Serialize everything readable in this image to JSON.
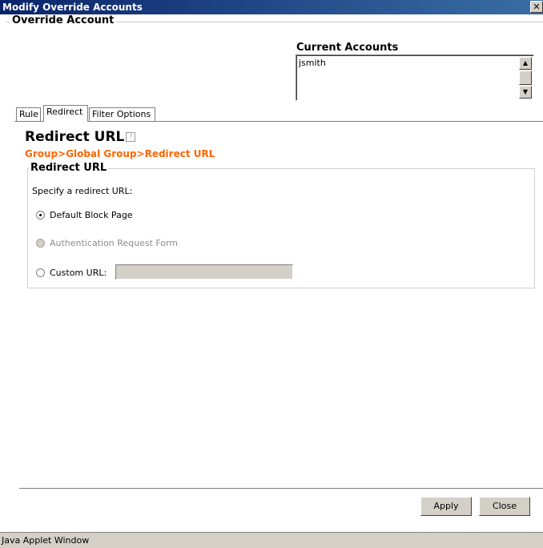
{
  "window": {
    "title": "Modify Override Accounts",
    "close_glyph": "✕"
  },
  "override_group": {
    "label": "Override Account"
  },
  "current_accounts": {
    "label": "Current Accounts",
    "items": [
      "jsmith"
    ]
  },
  "tabs": [
    {
      "label": "Rule",
      "active": false
    },
    {
      "label": "Redirect",
      "active": true
    },
    {
      "label": "Filter Options",
      "active": false
    }
  ],
  "redirect": {
    "title": "Redirect URL",
    "help_glyph": "?",
    "breadcrumb": "Group>Global Group>Redirect URL",
    "group_label": "Redirect URL",
    "instruction": "Specify a redirect URL:",
    "options": [
      {
        "label": "Default Block Page",
        "checked": true,
        "enabled": true
      },
      {
        "label": "Authentication Request Form",
        "checked": false,
        "enabled": false
      },
      {
        "label": "Custom URL:",
        "checked": false,
        "enabled": true
      }
    ],
    "custom_url_value": ""
  },
  "buttons": {
    "apply": "Apply",
    "close": "Close"
  },
  "status": "Java Applet Window",
  "colors": {
    "accent": "#ff6600",
    "titlebar": "#0a246a"
  }
}
